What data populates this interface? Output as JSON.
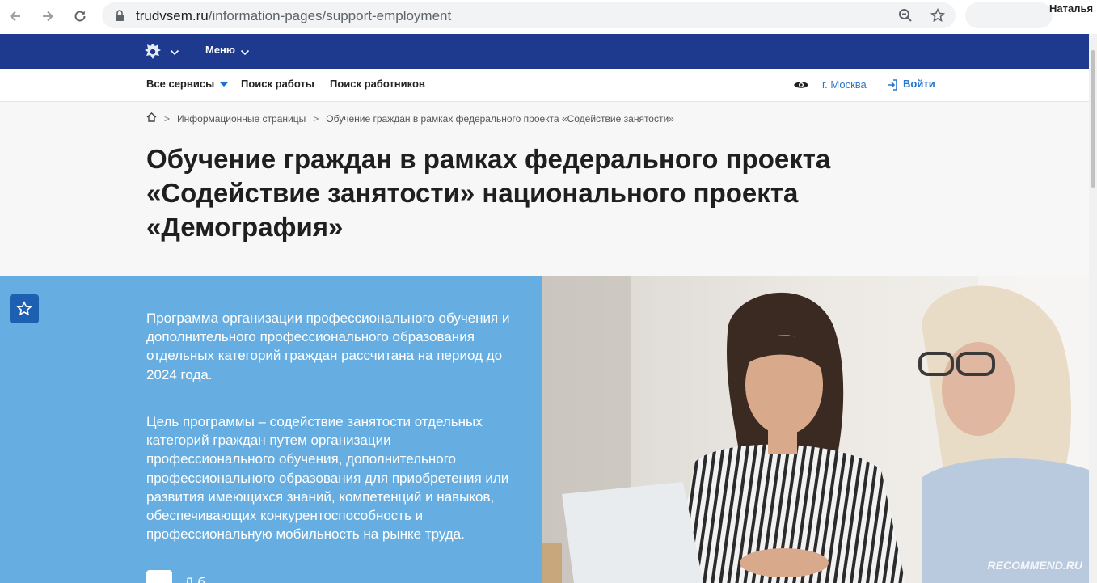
{
  "browser": {
    "url_host": "trudvsem.ru",
    "url_path": "/information-pages/support-employment",
    "profile_name": "Наталья"
  },
  "header": {
    "menu_label": "Меню"
  },
  "subnav": {
    "all_services": "Все сервисы",
    "job_search": "Поиск работы",
    "worker_search": "Поиск работников",
    "city": "г. Москва",
    "login": "Войти"
  },
  "breadcrumb": {
    "section": "Информационные страницы",
    "current": "Обучение граждан в рамках федерального проекта «Содействие занятости»"
  },
  "page": {
    "title_line1": "Обучение граждан в рамках федерального проекта",
    "title_line2": "«Содействие занятости» национального проекта",
    "title_line3": "«Демография»",
    "paragraph1": "Программа организации профессионального обучения и дополнительного профессионального образования отдельных категорий граждан рассчитана на период до 2024 года.",
    "paragraph2": "Цель программы – содействие занятости отдельных категорий граждан путем организации профессионального обучения, дополнительного профессионального образования для приобретения или развития имеющихся знаний, компетенций и навыков, обеспечивающих конкурентоспособность и профессиональную мобильность на рынке труда.",
    "doc_link_partial": "Д                    б"
  },
  "watermark": "RECOMMEND.RU",
  "colors": {
    "brand_blue": "#1d3a8f",
    "content_blue": "#66aee2",
    "link_blue": "#2a77c9"
  }
}
